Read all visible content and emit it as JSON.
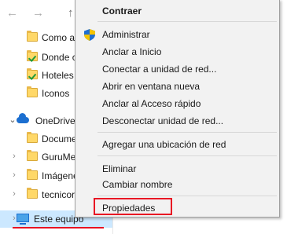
{
  "nav": {
    "back": "←",
    "forward": "→",
    "up": "↑"
  },
  "tree": {
    "items": [
      {
        "label": "Como a",
        "icon": "folder-icon"
      },
      {
        "label": "Donde c",
        "icon": "folder-check-icon"
      },
      {
        "label": "Hoteles",
        "icon": "folder-check-icon"
      },
      {
        "label": "Iconos",
        "icon": "folder-icon"
      }
    ],
    "onedrive": {
      "label": "OneDrive",
      "chevron": "⌄"
    },
    "onedrive_items": [
      {
        "label": "Documer",
        "chevron": ""
      },
      {
        "label": "GuruMe",
        "chevron": "›"
      },
      {
        "label": "Imágene",
        "chevron": "›"
      },
      {
        "label": "tecnicor",
        "chevron": "›"
      }
    ],
    "this_pc": {
      "label": "Este equipo",
      "chevron": "›"
    }
  },
  "context_menu": {
    "expand": "Contraer",
    "manage": "Administrar",
    "pin_start": "Anclar a Inicio",
    "map_drive": "Conectar a unidad de red...",
    "open_new_window": "Abrir en ventana nueva",
    "pin_quick_access": "Anclar al Acceso rápido",
    "disconnect_drive": "Desconectar unidad de red...",
    "add_network_location": "Agregar una ubicación de red",
    "delete": "Eliminar",
    "rename": "Cambiar nombre",
    "properties": "Propiedades"
  },
  "colors": {
    "highlight": "#e81123",
    "shield_blue": "#1f6fd1",
    "shield_yellow": "#f5c400"
  }
}
